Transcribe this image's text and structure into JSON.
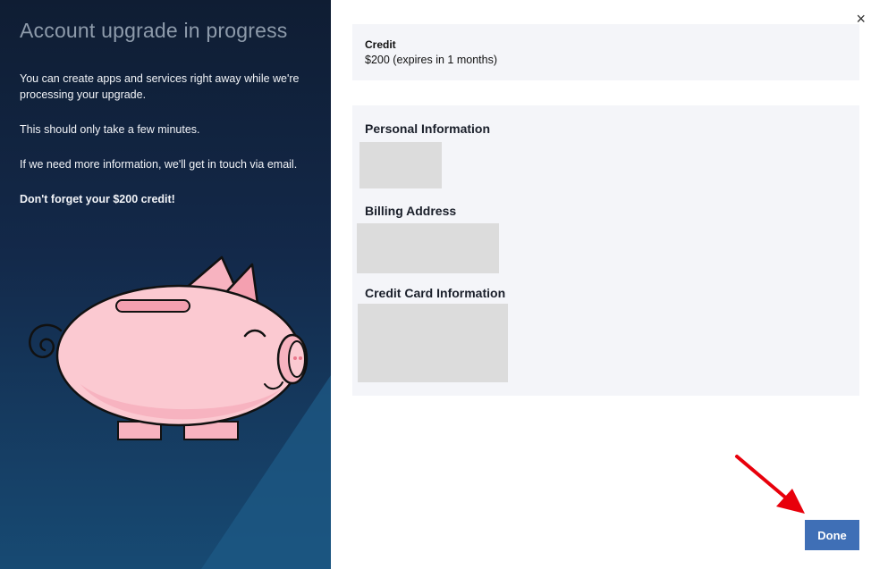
{
  "left_panel": {
    "title": "Account upgrade in progress",
    "paragraph1": "You can create apps and services right away while we're processing your upgrade.",
    "paragraph2": "This should only take a few minutes.",
    "paragraph3": "If we need more information, we'll get in touch via email.",
    "paragraph4": "Don't forget your $200 credit!"
  },
  "right_panel": {
    "close_icon": "×",
    "credit": {
      "label": "Credit",
      "value": "$200 (expires in 1 months)"
    },
    "sections": {
      "personal": "Personal Information",
      "billing": "Billing Address",
      "card": "Credit Card Information"
    },
    "done_label": "Done"
  },
  "colors": {
    "accent": "#3f6fb6",
    "panel_bg": "#f4f5f9",
    "arrow": "#e8000b"
  }
}
